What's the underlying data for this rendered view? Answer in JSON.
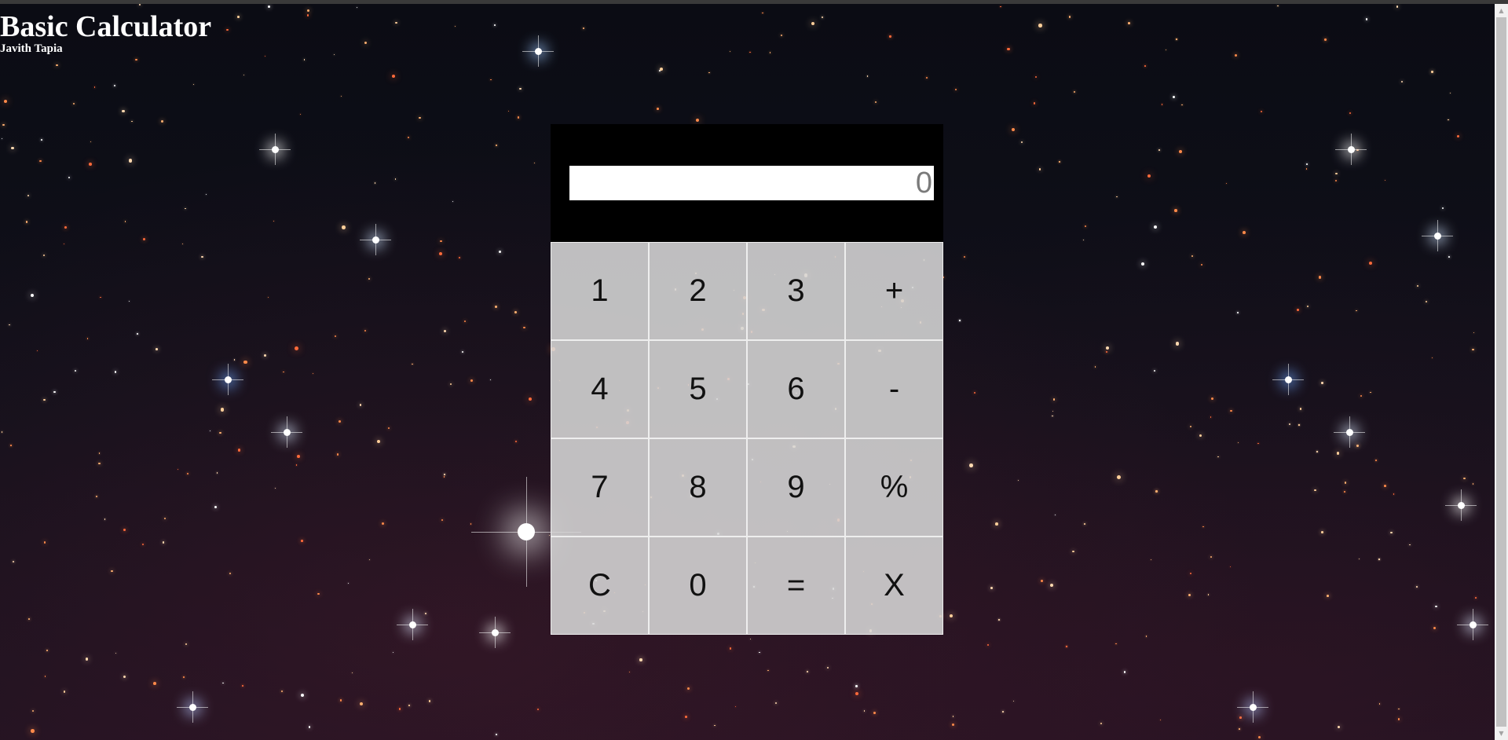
{
  "header": {
    "title": "Basic Calculator",
    "author": "Javith Tapia"
  },
  "display": {
    "placeholder": "0",
    "value": ""
  },
  "keypad": {
    "keys": [
      {
        "label": "1",
        "name": "key-1"
      },
      {
        "label": "2",
        "name": "key-2"
      },
      {
        "label": "3",
        "name": "key-3"
      },
      {
        "label": "+",
        "name": "key-add"
      },
      {
        "label": "4",
        "name": "key-4"
      },
      {
        "label": "5",
        "name": "key-5"
      },
      {
        "label": "6",
        "name": "key-6"
      },
      {
        "label": "-",
        "name": "key-subtract"
      },
      {
        "label": "7",
        "name": "key-7"
      },
      {
        "label": "8",
        "name": "key-8"
      },
      {
        "label": "9",
        "name": "key-9"
      },
      {
        "label": "%",
        "name": "key-percent"
      },
      {
        "label": "C",
        "name": "key-clear"
      },
      {
        "label": "0",
        "name": "key-0"
      },
      {
        "label": "=",
        "name": "key-equals"
      },
      {
        "label": "X",
        "name": "key-multiply"
      }
    ]
  },
  "colors": {
    "display_panel": "#000000",
    "key_background": "#d7d7d7",
    "key_border": "#eeeeee",
    "header_text": "#ffffff"
  },
  "icons": {
    "scroll_up": "scroll-up-arrow-icon",
    "scroll_down": "scroll-down-arrow-icon"
  }
}
